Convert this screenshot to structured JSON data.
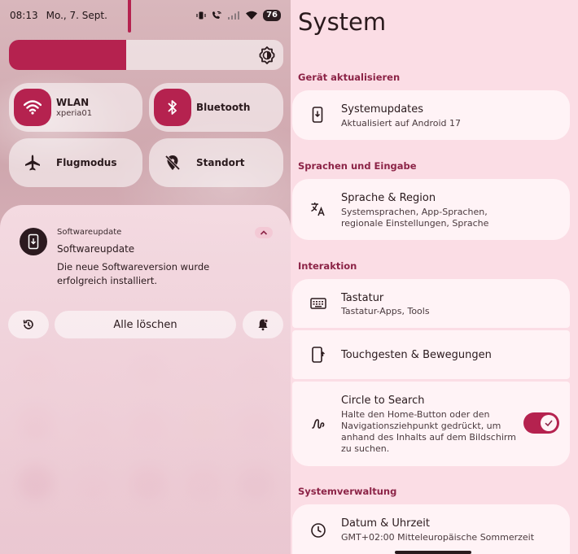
{
  "status_bar": {
    "time": "08:13",
    "date": "Mo., 7. Sept.",
    "battery": "76",
    "icons": [
      "vibrate-icon",
      "call-wifi-icon",
      "signal-icon",
      "wifi-icon",
      "battery-icon"
    ]
  },
  "brightness": {
    "level": 0.45
  },
  "tiles": {
    "wlan": {
      "title": "WLAN",
      "subtitle": "xperia01",
      "icon": "wifi-icon",
      "active": true
    },
    "bluetooth": {
      "title": "Bluetooth",
      "icon": "bluetooth-icon",
      "active": true
    },
    "airplane": {
      "title": "Flugmodus",
      "icon": "airplane-icon",
      "active": false
    },
    "location": {
      "title": "Standort",
      "icon": "location-off-icon",
      "active": false
    }
  },
  "notification": {
    "app_name": "Softwareupdate",
    "title": "Softwareupdate",
    "body": "Die neue Softwareversion wurde erfolgreich installiert.",
    "icon": "system-update-icon"
  },
  "notif_actions": {
    "history_icon": "history-icon",
    "clear_all": "Alle löschen",
    "dnd_icon": "notification-settings-icon"
  },
  "settings": {
    "title": "System",
    "sections": [
      {
        "header": "Gerät aktualisieren",
        "items": [
          {
            "title": "Systemupdates",
            "subtitle": "Aktualisiert auf Android 17",
            "icon": "system-update-icon"
          }
        ]
      },
      {
        "header": "Sprachen und Eingabe",
        "items": [
          {
            "title": "Sprache & Region",
            "subtitle": "Systemsprachen, App-Sprachen, regionale Einstellungen, Sprache",
            "icon": "translate-icon"
          }
        ]
      },
      {
        "header": "Interaktion",
        "items": [
          {
            "title": "Tastatur",
            "subtitle": "Tastatur-Apps, Tools",
            "icon": "keyboard-icon"
          },
          {
            "title": "Touchgesten & Bewegungen",
            "subtitle": "",
            "icon": "gesture-phone-icon"
          },
          {
            "title": "Circle to Search",
            "subtitle": "Halte den Home-Button oder den Navigationsziehpunkt gedrückt, um anhand des Inhalts auf dem Bildschirm zu suchen.",
            "icon": "circle-search-icon",
            "toggle": true
          }
        ]
      },
      {
        "header": "Systemverwaltung",
        "items": [
          {
            "title": "Datum & Uhrzeit",
            "subtitle": "GMT+02:00 Mitteleuropäische Sommerzeit",
            "icon": "clock-icon"
          }
        ]
      }
    ]
  },
  "colors": {
    "accent": "#b5224f",
    "section_header": "#8c2447",
    "card_bg": "#fff3f6",
    "panel_bg": "#fbdde5"
  }
}
